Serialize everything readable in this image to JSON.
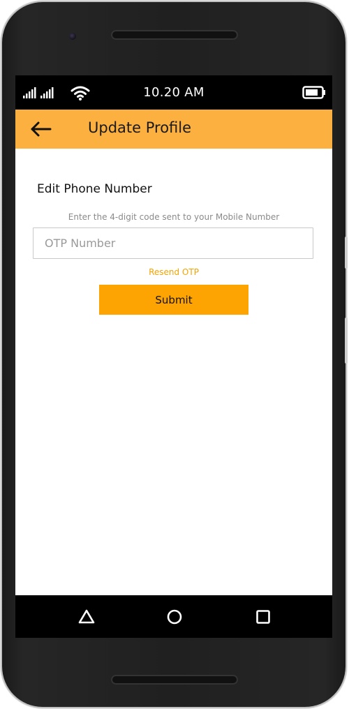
{
  "status_bar": {
    "time": "10.20 AM",
    "icons": [
      "signal-icon",
      "signal-icon",
      "wifi-icon",
      "battery-icon"
    ]
  },
  "app_bar": {
    "back_icon": "arrow-left-icon",
    "title": "Update Profile",
    "background_color": "#fbb040"
  },
  "form": {
    "heading": "Edit Phone Number",
    "helper_text": "Enter the 4-digit code sent to your Mobile Number",
    "otp_input": {
      "placeholder": "OTP Number",
      "value": ""
    },
    "resend_label": "Resend OTP",
    "submit_label": "Submit",
    "accent_color": "#fea402"
  },
  "nav_bar": {
    "buttons": [
      "back-triangle-icon",
      "home-circle-icon",
      "recents-square-icon"
    ]
  }
}
